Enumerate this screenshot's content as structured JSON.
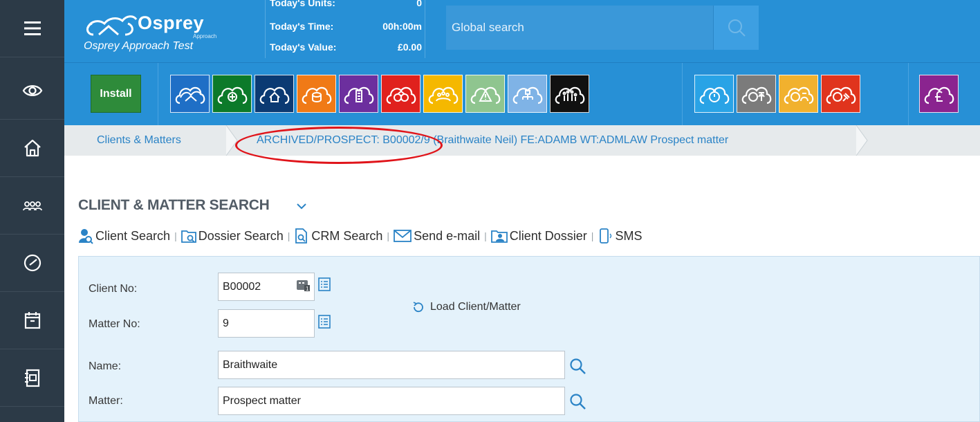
{
  "brand": {
    "logo_word": "Osprey",
    "logo_small": "Approach",
    "subtitle": "Osprey Approach Test"
  },
  "stats": [
    {
      "label": "Today's Units:",
      "value": "0"
    },
    {
      "label": "Today's Time:",
      "value": "00h:00m"
    },
    {
      "label": "Today's Value:",
      "value": "£0.00"
    }
  ],
  "search": {
    "placeholder": "Global search"
  },
  "sidebar": {
    "items": [
      {
        "name": "menu-icon"
      },
      {
        "name": "eye-icon"
      },
      {
        "name": "home-icon"
      },
      {
        "name": "people-icon"
      },
      {
        "name": "clock-icon"
      },
      {
        "name": "calendar-icon"
      },
      {
        "name": "ledger-icon"
      }
    ]
  },
  "toolbar": {
    "install_label": "Install",
    "modules": [
      {
        "name": "osprey-module-icon",
        "color": "#1f6fc6"
      },
      {
        "name": "add-cloud-icon",
        "color": "#0c7a2a"
      },
      {
        "name": "home-cloud-icon",
        "color": "#0b3a73"
      },
      {
        "name": "money-cloud-icon",
        "color": "#f07a16"
      },
      {
        "name": "building-cloud-icon",
        "color": "#6c2f9e"
      },
      {
        "name": "handcuffs-cloud-icon",
        "color": "#e0211d"
      },
      {
        "name": "people-cloud-icon",
        "color": "#f5b800"
      },
      {
        "name": "warning-cloud-icon",
        "color": "#8fc58f"
      },
      {
        "name": "org-chart-cloud-icon",
        "color": "#7fb3e6"
      },
      {
        "name": "family-cloud-icon",
        "color": "#111111"
      },
      {
        "name": "stopwatch-cloud-icon",
        "color": "#29a3e6"
      },
      {
        "name": "scales-cloud-icon",
        "color": "#7b7b7b"
      },
      {
        "name": "team-time-cloud-icon",
        "color": "#f1b12e"
      },
      {
        "name": "gavel-cloud-icon",
        "color": "#e0341d"
      },
      {
        "name": "pound-cloud-icon",
        "color": "#8a248f"
      }
    ]
  },
  "breadcrumb": {
    "root": "Clients & Matters",
    "current": "ARCHIVED/PROSPECT: B00002/9 (Braithwaite Neil) FE:ADAMB WT:ADMLAW Prospect matter"
  },
  "page": {
    "title": "CLIENT & MATTER SEARCH"
  },
  "actions": [
    {
      "label": "Client Search"
    },
    {
      "label": "Dossier Search"
    },
    {
      "label": "CRM Search"
    },
    {
      "label": "Send e-mail"
    },
    {
      "label": "Client Dossier"
    },
    {
      "label": "SMS"
    }
  ],
  "form": {
    "client_no_label": "Client No:",
    "client_no_value": "B00002",
    "matter_no_label": "Matter No:",
    "matter_no_value": "9",
    "name_label": "Name:",
    "name_value": "Braithwaite",
    "matter_label": "Matter:",
    "matter_value": "Prospect matter",
    "load_label": "Load Client/Matter"
  },
  "colors": {
    "topbar": "#2790d6",
    "sidebar": "#2c3a47",
    "link": "#2a83c6",
    "install": "#2e8b3a",
    "annotation": "#e0141a"
  }
}
